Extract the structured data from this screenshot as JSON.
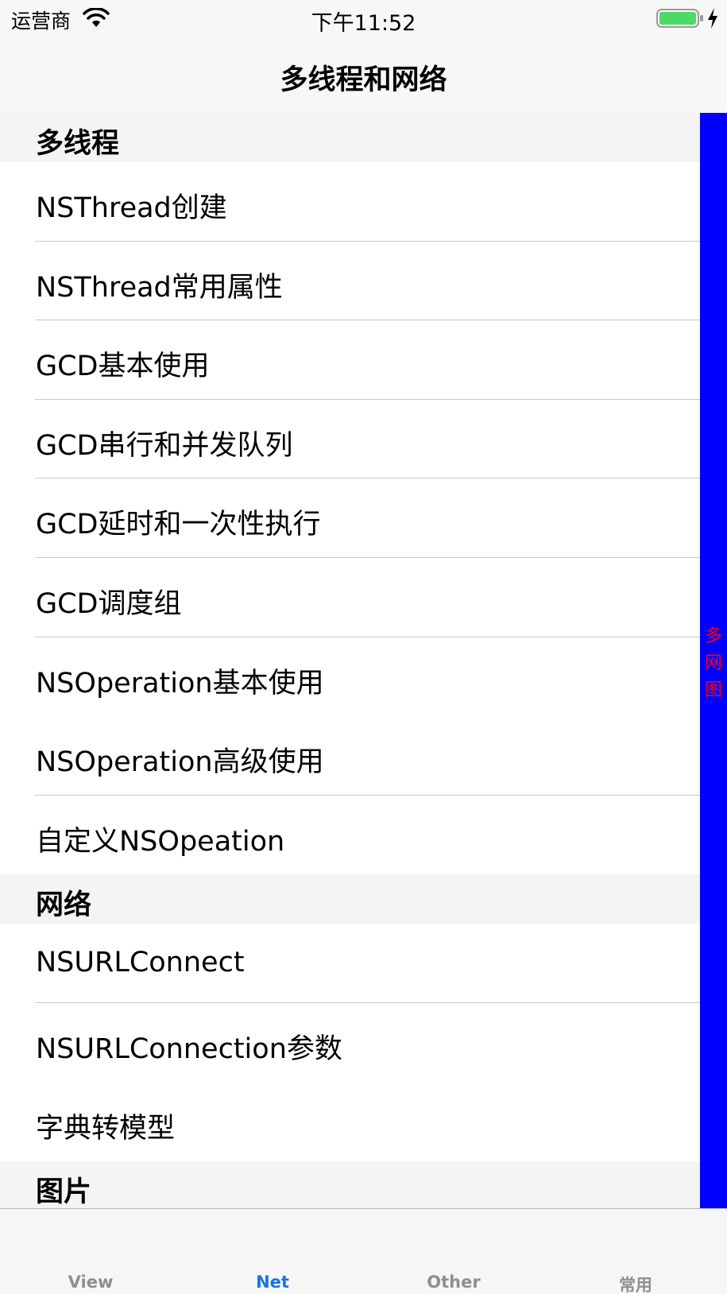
{
  "status_bar": {
    "carrier": "运营商",
    "time": "下午11:52"
  },
  "nav": {
    "title": "多线程和网络"
  },
  "sections": [
    {
      "header": "多线程",
      "rows": [
        "NSThread创建",
        "NSThread常用属性",
        "GCD基本使用",
        "GCD串行和并发队列",
        "GCD延时和一次性执行",
        "GCD调度组",
        "NSOperation基本使用",
        "NSOperation高级使用",
        "自定义NSOpeation"
      ]
    },
    {
      "header": "网络",
      "rows": [
        "NSURLConnect",
        "NSURLConnection参数",
        "字典转模型"
      ]
    },
    {
      "header": "图片",
      "rows": []
    }
  ],
  "index_bar": {
    "items": [
      "多",
      "网",
      "图"
    ],
    "background": "#0000ff",
    "text_color": "#ff0000"
  },
  "tab_bar": {
    "tabs": [
      "View",
      "Net",
      "Other",
      "常用"
    ],
    "active": "Net",
    "active_color": "#1a73e8"
  }
}
